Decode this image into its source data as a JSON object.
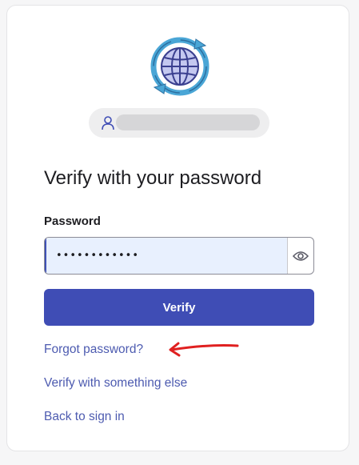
{
  "user": {
    "icon": "person-icon",
    "identifier_redacted": true
  },
  "logo": {
    "icon": "globe-sync-icon"
  },
  "heading": "Verify with your password",
  "password": {
    "label": "Password",
    "value": "••••••••••••",
    "toggle_icon": "eye-icon"
  },
  "verify_button": "Verify",
  "links": {
    "forgot": "Forgot password?",
    "verify_else": "Verify with something else",
    "back": "Back to sign in"
  },
  "annotation": {
    "icon": "red-arrow-icon",
    "color": "#e02020"
  },
  "colors": {
    "primary": "#3f4db5",
    "link": "#4d5bb0",
    "input_fill": "#e8f0fe"
  }
}
